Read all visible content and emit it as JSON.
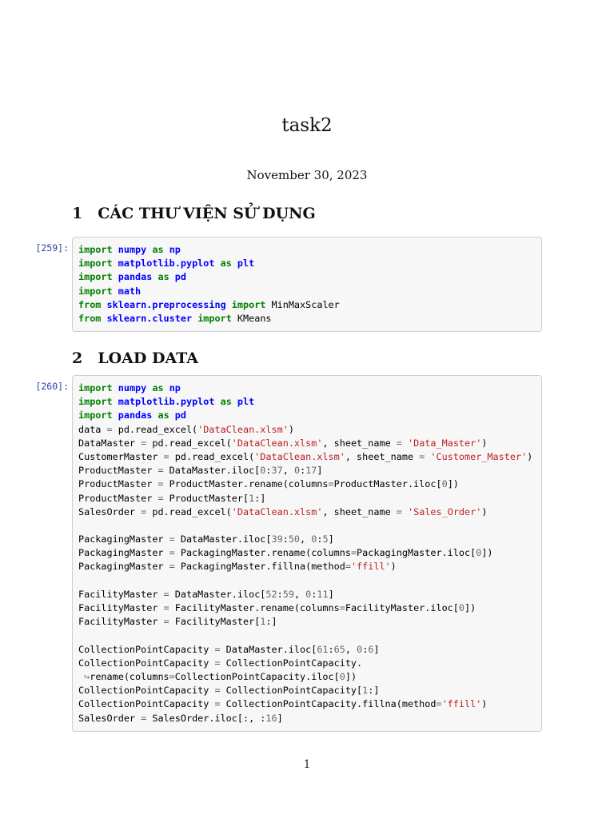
{
  "document": {
    "title": "task2",
    "date": "November 30, 2023",
    "page_number": "1"
  },
  "sections": [
    {
      "number": "1",
      "title": "CÁC THƯ VIỆN SỬ DỤNG"
    },
    {
      "number": "2",
      "title": "LOAD DATA"
    }
  ],
  "colors": {
    "prompt": "#303F9F",
    "keyword": "#008000",
    "module": "#0000FF",
    "string": "#BA2121",
    "number": "#666666",
    "operator": "#666666",
    "continuation": "#777777",
    "cell_background": "#F7F7F7",
    "cell_border": "#CFCFCF"
  },
  "cells": [
    {
      "prompt": "[259]:",
      "lines": [
        [
          [
            "kw",
            "import"
          ],
          [
            "tx",
            " "
          ],
          [
            "nn",
            "numpy"
          ],
          [
            "tx",
            " "
          ],
          [
            "kw",
            "as"
          ],
          [
            "tx",
            " "
          ],
          [
            "nn",
            "np"
          ]
        ],
        [
          [
            "kw",
            "import"
          ],
          [
            "tx",
            " "
          ],
          [
            "nn",
            "matplotlib.pyplot"
          ],
          [
            "tx",
            " "
          ],
          [
            "kw",
            "as"
          ],
          [
            "tx",
            " "
          ],
          [
            "nn",
            "plt"
          ]
        ],
        [
          [
            "kw",
            "import"
          ],
          [
            "tx",
            " "
          ],
          [
            "nn",
            "pandas"
          ],
          [
            "tx",
            " "
          ],
          [
            "kw",
            "as"
          ],
          [
            "tx",
            " "
          ],
          [
            "nn",
            "pd"
          ]
        ],
        [
          [
            "kw",
            "import"
          ],
          [
            "tx",
            " "
          ],
          [
            "nn",
            "math"
          ]
        ],
        [
          [
            "kw",
            "from"
          ],
          [
            "tx",
            " "
          ],
          [
            "nn",
            "sklearn.preprocessing"
          ],
          [
            "tx",
            " "
          ],
          [
            "kw",
            "import"
          ],
          [
            "tx",
            " MinMaxScaler"
          ]
        ],
        [
          [
            "kw",
            "from"
          ],
          [
            "tx",
            " "
          ],
          [
            "nn",
            "sklearn.cluster"
          ],
          [
            "tx",
            " "
          ],
          [
            "kw",
            "import"
          ],
          [
            "tx",
            " KMeans"
          ]
        ]
      ]
    },
    {
      "prompt": "[260]:",
      "lines": [
        [
          [
            "kw",
            "import"
          ],
          [
            "tx",
            " "
          ],
          [
            "nn",
            "numpy"
          ],
          [
            "tx",
            " "
          ],
          [
            "kw",
            "as"
          ],
          [
            "tx",
            " "
          ],
          [
            "nn",
            "np"
          ]
        ],
        [
          [
            "kw",
            "import"
          ],
          [
            "tx",
            " "
          ],
          [
            "nn",
            "matplotlib.pyplot"
          ],
          [
            "tx",
            " "
          ],
          [
            "kw",
            "as"
          ],
          [
            "tx",
            " "
          ],
          [
            "nn",
            "plt"
          ]
        ],
        [
          [
            "kw",
            "import"
          ],
          [
            "tx",
            " "
          ],
          [
            "nn",
            "pandas"
          ],
          [
            "tx",
            " "
          ],
          [
            "kw",
            "as"
          ],
          [
            "tx",
            " "
          ],
          [
            "nn",
            "pd"
          ]
        ],
        [
          [
            "tx",
            "data "
          ],
          [
            "o",
            "="
          ],
          [
            "tx",
            " pd.read_excel("
          ],
          [
            "s",
            "'DataClean.xlsm'"
          ],
          [
            "tx",
            ")"
          ]
        ],
        [
          [
            "tx",
            "DataMaster "
          ],
          [
            "o",
            "="
          ],
          [
            "tx",
            " pd.read_excel("
          ],
          [
            "s",
            "'DataClean.xlsm'"
          ],
          [
            "tx",
            ", sheet_name "
          ],
          [
            "o",
            "="
          ],
          [
            "tx",
            " "
          ],
          [
            "s",
            "'Data_Master'"
          ],
          [
            "tx",
            ")"
          ]
        ],
        [
          [
            "tx",
            "CustomerMaster "
          ],
          [
            "o",
            "="
          ],
          [
            "tx",
            " pd.read_excel("
          ],
          [
            "s",
            "'DataClean.xlsm'"
          ],
          [
            "tx",
            ", sheet_name "
          ],
          [
            "o",
            "="
          ],
          [
            "tx",
            " "
          ],
          [
            "s",
            "'Customer_Master'"
          ],
          [
            "tx",
            ")"
          ]
        ],
        [
          [
            "tx",
            "ProductMaster "
          ],
          [
            "o",
            "="
          ],
          [
            "tx",
            " DataMaster.iloc["
          ],
          [
            "mi",
            "0"
          ],
          [
            "tx",
            ":"
          ],
          [
            "mi",
            "37"
          ],
          [
            "tx",
            ", "
          ],
          [
            "mi",
            "0"
          ],
          [
            "tx",
            ":"
          ],
          [
            "mi",
            "17"
          ],
          [
            "tx",
            "]"
          ]
        ],
        [
          [
            "tx",
            "ProductMaster "
          ],
          [
            "o",
            "="
          ],
          [
            "tx",
            " ProductMaster.rename(columns"
          ],
          [
            "o",
            "="
          ],
          [
            "tx",
            "ProductMaster.iloc["
          ],
          [
            "mi",
            "0"
          ],
          [
            "tx",
            "])"
          ]
        ],
        [
          [
            "tx",
            "ProductMaster "
          ],
          [
            "o",
            "="
          ],
          [
            "tx",
            " ProductMaster["
          ],
          [
            "mi",
            "1"
          ],
          [
            "tx",
            ":]"
          ]
        ],
        [
          [
            "tx",
            "SalesOrder "
          ],
          [
            "o",
            "="
          ],
          [
            "tx",
            " pd.read_excel("
          ],
          [
            "s",
            "'DataClean.xlsm'"
          ],
          [
            "tx",
            ", sheet_name "
          ],
          [
            "o",
            "="
          ],
          [
            "tx",
            " "
          ],
          [
            "s",
            "'Sales_Order'"
          ],
          [
            "tx",
            ")"
          ]
        ],
        [],
        [
          [
            "tx",
            "PackagingMaster "
          ],
          [
            "o",
            "="
          ],
          [
            "tx",
            " DataMaster.iloc["
          ],
          [
            "mi",
            "39"
          ],
          [
            "tx",
            ":"
          ],
          [
            "mi",
            "50"
          ],
          [
            "tx",
            ", "
          ],
          [
            "mi",
            "0"
          ],
          [
            "tx",
            ":"
          ],
          [
            "mi",
            "5"
          ],
          [
            "tx",
            "]"
          ]
        ],
        [
          [
            "tx",
            "PackagingMaster "
          ],
          [
            "o",
            "="
          ],
          [
            "tx",
            " PackagingMaster.rename(columns"
          ],
          [
            "o",
            "="
          ],
          [
            "tx",
            "PackagingMaster.iloc["
          ],
          [
            "mi",
            "0"
          ],
          [
            "tx",
            "])"
          ]
        ],
        [
          [
            "tx",
            "PackagingMaster "
          ],
          [
            "o",
            "="
          ],
          [
            "tx",
            " PackagingMaster.fillna(method"
          ],
          [
            "o",
            "="
          ],
          [
            "s",
            "'ffill'"
          ],
          [
            "tx",
            ")"
          ]
        ],
        [],
        [
          [
            "tx",
            "FacilityMaster "
          ],
          [
            "o",
            "="
          ],
          [
            "tx",
            " DataMaster.iloc["
          ],
          [
            "mi",
            "52"
          ],
          [
            "tx",
            ":"
          ],
          [
            "mi",
            "59"
          ],
          [
            "tx",
            ", "
          ],
          [
            "mi",
            "0"
          ],
          [
            "tx",
            ":"
          ],
          [
            "mi",
            "11"
          ],
          [
            "tx",
            "]"
          ]
        ],
        [
          [
            "tx",
            "FacilityMaster "
          ],
          [
            "o",
            "="
          ],
          [
            "tx",
            " FacilityMaster.rename(columns"
          ],
          [
            "o",
            "="
          ],
          [
            "tx",
            "FacilityMaster.iloc["
          ],
          [
            "mi",
            "0"
          ],
          [
            "tx",
            "])"
          ]
        ],
        [
          [
            "tx",
            "FacilityMaster "
          ],
          [
            "o",
            "="
          ],
          [
            "tx",
            " FacilityMaster["
          ],
          [
            "mi",
            "1"
          ],
          [
            "tx",
            ":]"
          ]
        ],
        [],
        [
          [
            "tx",
            "CollectionPointCapacity "
          ],
          [
            "o",
            "="
          ],
          [
            "tx",
            " DataMaster.iloc["
          ],
          [
            "mi",
            "61"
          ],
          [
            "tx",
            ":"
          ],
          [
            "mi",
            "65"
          ],
          [
            "tx",
            ", "
          ],
          [
            "mi",
            "0"
          ],
          [
            "tx",
            ":"
          ],
          [
            "mi",
            "6"
          ],
          [
            "tx",
            "]"
          ]
        ],
        [
          [
            "tx",
            "CollectionPointCapacity "
          ],
          [
            "o",
            "="
          ],
          [
            "tx",
            " CollectionPointCapacity."
          ]
        ],
        [
          [
            "tx",
            " "
          ],
          [
            "cont",
            "↪"
          ],
          [
            "tx",
            "rename(columns"
          ],
          [
            "o",
            "="
          ],
          [
            "tx",
            "CollectionPointCapacity.iloc["
          ],
          [
            "mi",
            "0"
          ],
          [
            "tx",
            "])"
          ]
        ],
        [
          [
            "tx",
            "CollectionPointCapacity "
          ],
          [
            "o",
            "="
          ],
          [
            "tx",
            " CollectionPointCapacity["
          ],
          [
            "mi",
            "1"
          ],
          [
            "tx",
            ":]"
          ]
        ],
        [
          [
            "tx",
            "CollectionPointCapacity "
          ],
          [
            "o",
            "="
          ],
          [
            "tx",
            " CollectionPointCapacity.fillna(method"
          ],
          [
            "o",
            "="
          ],
          [
            "s",
            "'ffill'"
          ],
          [
            "tx",
            ")"
          ]
        ],
        [
          [
            "tx",
            "SalesOrder "
          ],
          [
            "o",
            "="
          ],
          [
            "tx",
            " SalesOrder.iloc[:, :"
          ],
          [
            "mi",
            "16"
          ],
          [
            "tx",
            "]"
          ]
        ]
      ]
    }
  ]
}
